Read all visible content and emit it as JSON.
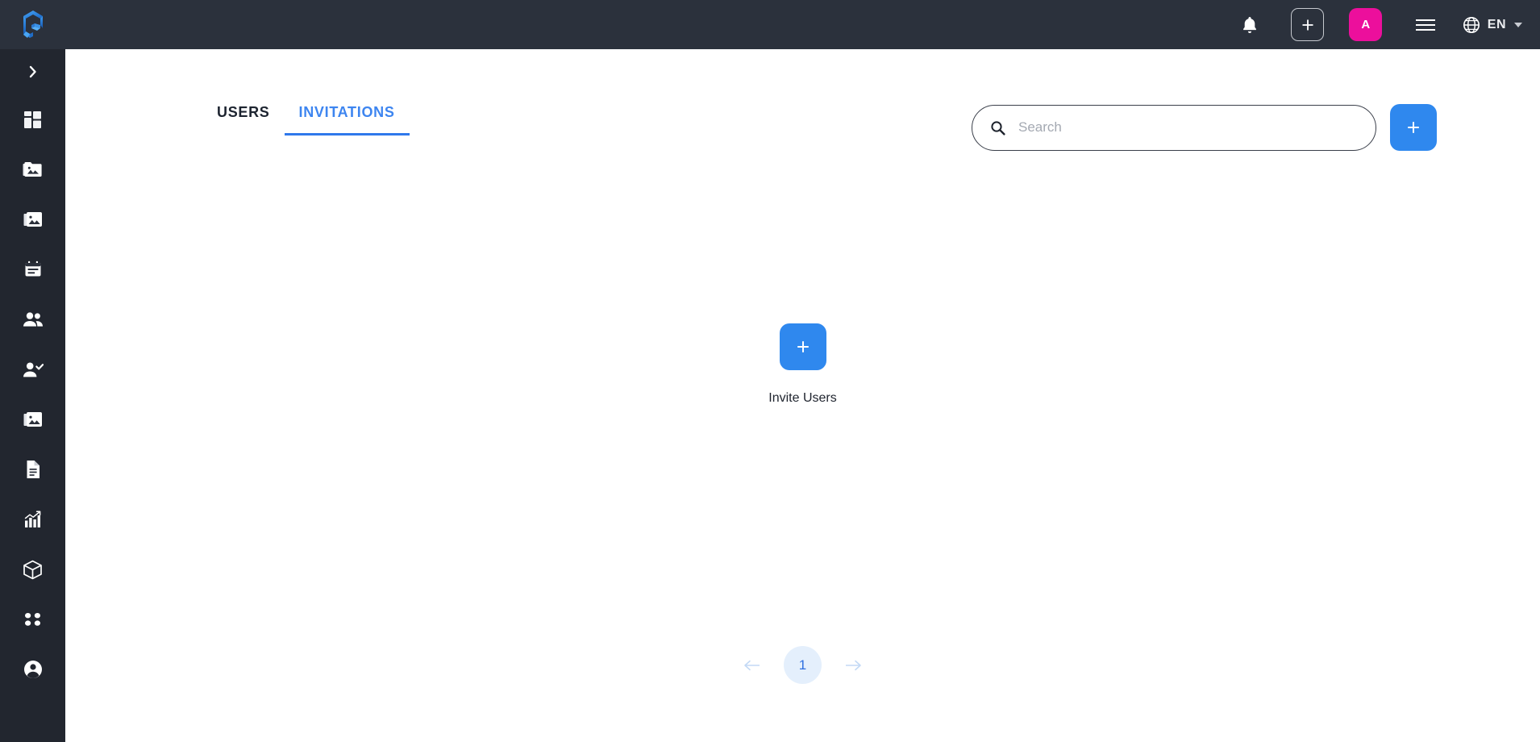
{
  "topbar": {
    "logo_icon": "cube-logo-icon",
    "notifications_icon": "bell-icon",
    "add_icon": "plus-icon",
    "avatar_initial": "A",
    "menu_icon": "hamburger-menu-icon",
    "globe_icon": "globe-icon",
    "language": "EN",
    "caret_icon": "chevron-down-icon",
    "accent_pink": "#ec0f9c",
    "background": "#2b313c"
  },
  "sidebar": {
    "background": "#22262f",
    "toggle_icon": "chevron-right-icon",
    "items": [
      {
        "icon": "dashboard-grid-icon",
        "name": "sidebar-item-dashboard"
      },
      {
        "icon": "folder-image-icon",
        "name": "sidebar-item-media-folders"
      },
      {
        "icon": "image-stack-icon",
        "name": "sidebar-item-galleries"
      },
      {
        "icon": "calendar-icon",
        "name": "sidebar-item-events"
      },
      {
        "icon": "people-icon",
        "name": "sidebar-item-users"
      },
      {
        "icon": "person-check-icon",
        "name": "sidebar-item-approvals"
      },
      {
        "icon": "image-stack-icon",
        "name": "sidebar-item-assets"
      },
      {
        "icon": "document-icon",
        "name": "sidebar-item-documents"
      },
      {
        "icon": "bar-chart-icon",
        "name": "sidebar-item-analytics"
      },
      {
        "icon": "box-3d-icon",
        "name": "sidebar-item-packages"
      },
      {
        "icon": "apps-grid-icon",
        "name": "sidebar-item-apps"
      },
      {
        "icon": "account-circle-icon",
        "name": "sidebar-item-account"
      }
    ]
  },
  "main": {
    "tabs": [
      {
        "label": "USERS",
        "active": false
      },
      {
        "label": "INVITATIONS",
        "active": true
      }
    ],
    "search": {
      "placeholder": "Search",
      "value": "",
      "icon": "search-icon"
    },
    "add_button": {
      "icon": "plus-icon",
      "color": "#2f88ee"
    },
    "invite": {
      "icon": "plus-icon",
      "label": "Invite Users",
      "color": "#2f88ee"
    },
    "pagination": {
      "prev_icon": "arrow-left-icon",
      "next_icon": "arrow-right-icon",
      "current_page": "1",
      "active_bg": "#e4effc",
      "active_color": "#2f6fe0"
    }
  }
}
